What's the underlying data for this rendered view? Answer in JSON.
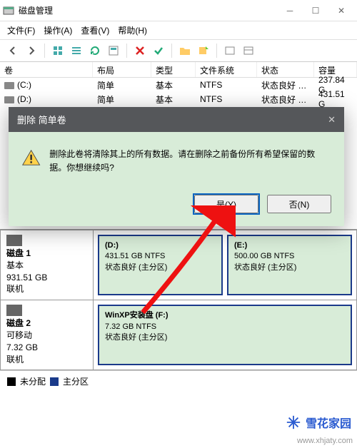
{
  "window": {
    "title": "磁盘管理"
  },
  "menu": {
    "file": "文件(F)",
    "action": "操作(A)",
    "view": "查看(V)",
    "help": "帮助(H)"
  },
  "columns": {
    "volume": "卷",
    "layout": "布局",
    "type": "类型",
    "fs": "文件系统",
    "status": "状态",
    "capacity": "容量"
  },
  "rows": [
    {
      "vol": "(C:)",
      "layout": "简单",
      "type": "基本",
      "fs": "NTFS",
      "status": "状态良好 …",
      "cap": "237.84 G"
    },
    {
      "vol": "(D:)",
      "layout": "简单",
      "type": "基本",
      "fs": "NTFS",
      "status": "状态良好 …",
      "cap": "431.51 G"
    }
  ],
  "disks": [
    {
      "icon": "disk",
      "name": "磁盘 1",
      "type": "基本",
      "size": "931.51 GB",
      "state": "联机",
      "partitions": [
        {
          "name": "(D:)",
          "line2": "431.51 GB NTFS",
          "line3": "状态良好 (主分区)"
        },
        {
          "name": "(E:)",
          "line2": "500.00 GB NTFS",
          "line3": "状态良好 (主分区)"
        }
      ]
    },
    {
      "icon": "usb",
      "name": "磁盘 2",
      "type": "可移动",
      "size": "7.32 GB",
      "state": "联机",
      "partitions": [
        {
          "name": "WinXP安装盘   (F:)",
          "line2": "7.32 GB NTFS",
          "line3": "状态良好 (主分区)"
        }
      ]
    }
  ],
  "legend": {
    "unalloc": "未分配",
    "primary": "主分区"
  },
  "dialog": {
    "title": "删除 简单卷",
    "message": "删除此卷将清除其上的所有数据。请在删除之前备份所有希望保留的数据。你想继续吗?",
    "yes": "是(Y)",
    "no": "否(N)"
  },
  "watermark": {
    "text": "雪花家园",
    "url": "www.xhjaty.com"
  }
}
